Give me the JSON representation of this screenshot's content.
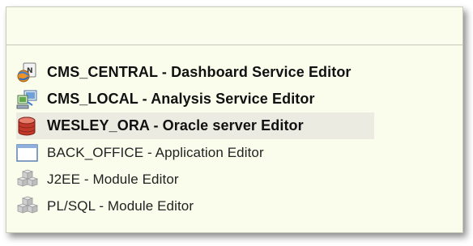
{
  "items": [
    {
      "label": "CMS_CENTRAL - Dashboard Service Editor",
      "icon": "dashboard-service-icon",
      "bold": true
    },
    {
      "label": "CMS_LOCAL - Analysis Service Editor",
      "icon": "analysis-service-icon",
      "bold": true
    },
    {
      "label": "WESLEY_ORA - Oracle server Editor",
      "icon": "database-icon",
      "bold": true,
      "selected": true
    },
    {
      "label": "BACK_OFFICE - Application Editor",
      "icon": "application-window-icon",
      "bold": false
    },
    {
      "label": "J2EE - Module Editor",
      "icon": "module-cubes-icon",
      "bold": false
    },
    {
      "label": "PL/SQL - Module Editor",
      "icon": "module-cubes-icon",
      "bold": false
    }
  ],
  "colors": {
    "panel_background": "#fbfdec",
    "selection_background": "#ebebe2",
    "database_red": "#c0392b"
  }
}
